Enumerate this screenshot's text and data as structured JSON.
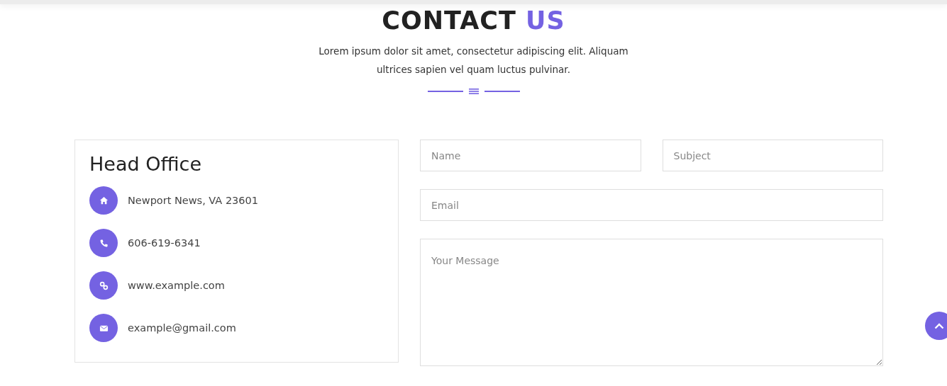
{
  "header": {
    "title": "CONTACT",
    "title_accent": "US",
    "subtitle": "Lorem ipsum dolor sit amet, consectetur adipiscing elit. Aliquam ultrices sapien vel quam luctus pulvinar."
  },
  "office": {
    "title": "Head Office",
    "items": [
      {
        "kind": "address",
        "text": "Newport News, VA 23601"
      },
      {
        "kind": "phone",
        "text": "606-619-6341"
      },
      {
        "kind": "website",
        "text": "www.example.com"
      },
      {
        "kind": "email",
        "text": "example@gmail.com"
      }
    ]
  },
  "form": {
    "name": {
      "placeholder": "Name"
    },
    "subject": {
      "placeholder": "Subject"
    },
    "email": {
      "placeholder": "Email"
    },
    "message": {
      "placeholder": "Your Message"
    }
  }
}
